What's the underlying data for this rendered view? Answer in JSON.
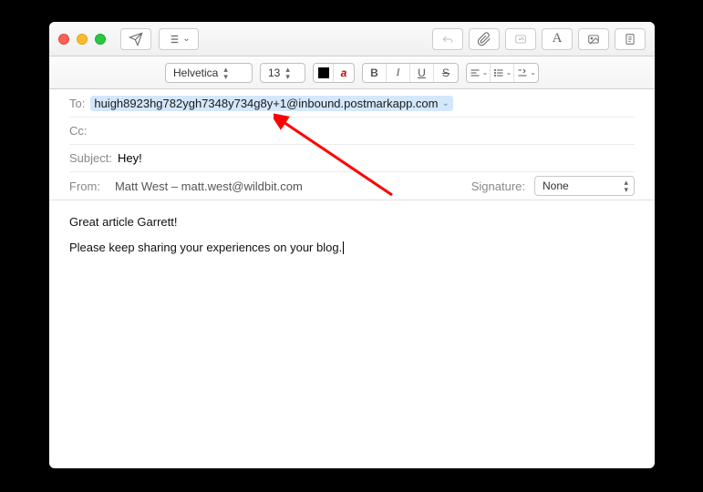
{
  "toolbar": {
    "font_family": "Helvetica",
    "font_size": "13"
  },
  "headers": {
    "to_label": "To:",
    "to_value": "huigh8923hg782ygh7348y734g8y+1@inbound.postmarkapp.com",
    "cc_label": "Cc:",
    "cc_value": "",
    "subject_label": "Subject:",
    "subject_value": "Hey!",
    "from_label": "From:",
    "from_value": "Matt West – matt.west@wildbit.com",
    "signature_label": "Signature:",
    "signature_value": "None"
  },
  "body": {
    "line1": "Great article Garrett!",
    "line2": "Please keep sharing your experiences on your blog."
  },
  "annotation": {
    "arrow_color": "#ff0000"
  }
}
